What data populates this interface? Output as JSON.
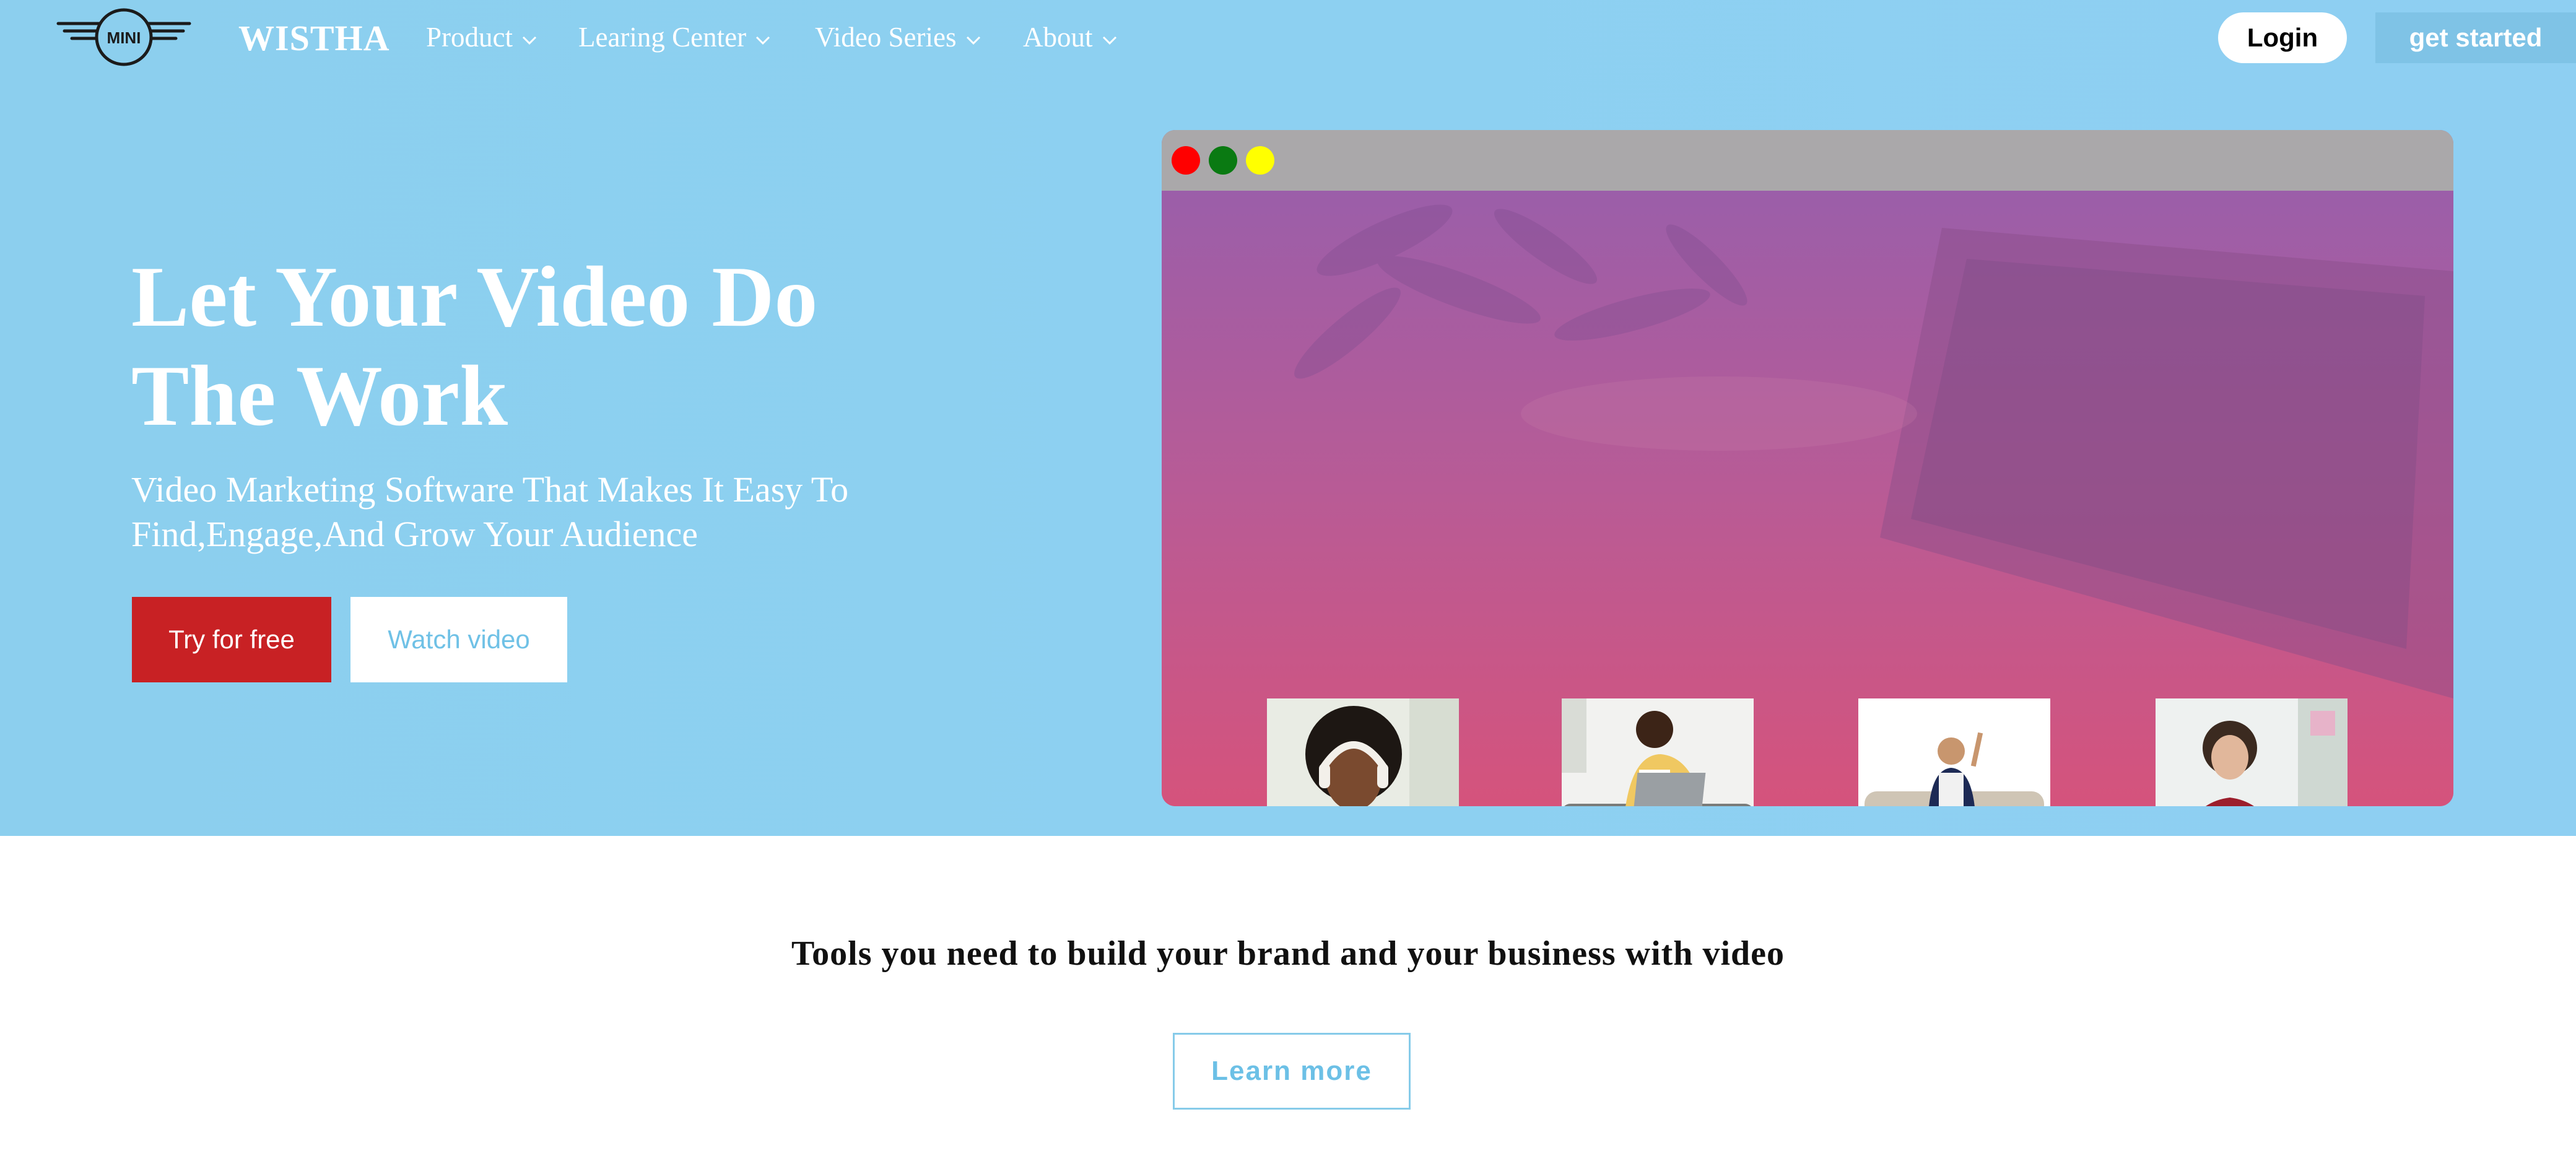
{
  "nav": {
    "brand": "WISTHA",
    "logo_text": "MINI",
    "items": [
      {
        "label": "Product"
      },
      {
        "label": "Learing Center"
      },
      {
        "label": "Video Series"
      },
      {
        "label": "About"
      }
    ],
    "login_label": "Login",
    "get_started_label": "get started"
  },
  "hero": {
    "headline_line1": "Let Your Video Do",
    "headline_line2": "The Work",
    "subhead_line1": "Video Marketing Software That Makes It Easy To",
    "subhead_line2": "Find,Engage,And Grow Your Audience",
    "try_label": "Try for free",
    "watch_label": "Watch video"
  },
  "browser": {
    "dots": [
      {
        "name": "close-dot",
        "color": "#ff0000"
      },
      {
        "name": "minimize-dot",
        "color": "#0a7a12"
      },
      {
        "name": "maximize-dot",
        "color": "#ffff00"
      }
    ],
    "thumbnails": [
      {
        "name": "thumbnail-woman-headphones"
      },
      {
        "name": "thumbnail-man-couch-laptop"
      },
      {
        "name": "thumbnail-man-sofa-peace-sign"
      },
      {
        "name": "thumbnail-woman-desk-laptop"
      }
    ]
  },
  "section": {
    "tagline": "Tools you need to build your brand and your business with video",
    "learn_more_label": "Learn more"
  },
  "colors": {
    "hero_background": "#8dd0f1",
    "primary_red": "#c82124",
    "accent_blue": "#6fc1e6"
  }
}
